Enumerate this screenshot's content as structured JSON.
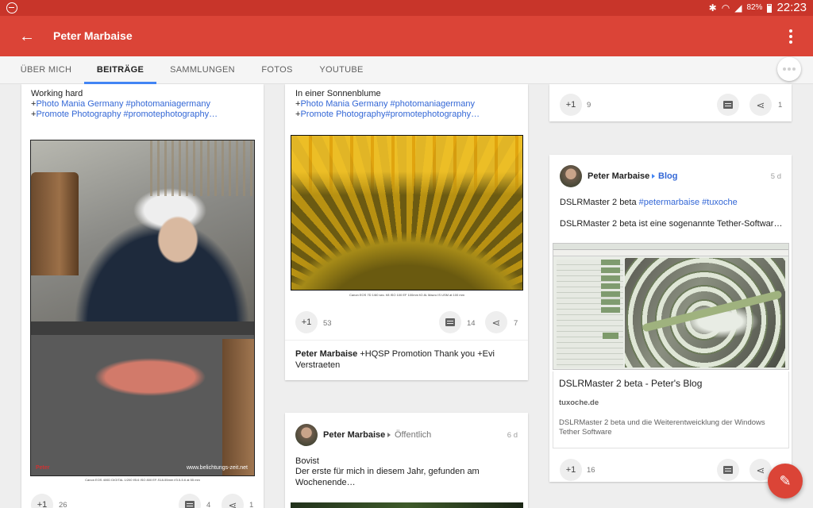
{
  "status_bar": {
    "battery": "82%",
    "time": "22:23"
  },
  "app_bar": {
    "title": "Peter Marbaise"
  },
  "tabs": [
    {
      "label": "ÜBER MICH"
    },
    {
      "label": "BEITRÄGE",
      "active": true
    },
    {
      "label": "SAMMLUNGEN"
    },
    {
      "label": "FOTOS"
    },
    {
      "label": "YOUTUBE"
    }
  ],
  "posts": {
    "working_hard": {
      "line1": "Working hard",
      "line2_prefix": "+",
      "line2_link": "Photo Mania Germany #photomaniagermany",
      "line3_prefix": "+",
      "line3_link": "Promote Photography #promotephotography…",
      "photo_watermark": "www.belichtungs-zeit.net",
      "photo_caption": "Canon EOS 400D DIGITAL 1/200 f/5.6 ISO 800 EF-S18-55mm f/3.5-5.6 at 55 mm",
      "plus_one": "+1",
      "plus_count": "26",
      "comments": "4",
      "shares": "1"
    },
    "sonnenblume": {
      "line1": "In einer Sonnenblume",
      "line2_prefix": "+",
      "line2_link": "Photo Mania Germany #photomaniagermany",
      "line3_prefix": "+",
      "line3_link": "Promote Photography#promotephotography…",
      "photo_caption": "Canon EOS 7D 1/60 sec. f/8 ISO 100 EF 100mm f/2.8L Macro IS USM at 100 mm",
      "plus_one": "+1",
      "plus_count": "53",
      "comments": "14",
      "shares": "7",
      "comment_author": "Peter Marbaise",
      "comment_text": " +HQSP Promotion Thank you +Evi Verstraeten"
    },
    "bovist": {
      "author": "Peter Marbaise",
      "audience": "Öffentlich",
      "date": "6 d",
      "line1": "Bovist",
      "line2": "Der erste für mich in diesem Jahr, gefunden am Wochenende…"
    },
    "top_right": {
      "plus_one": "+1",
      "plus_count": "9",
      "shares": "1"
    },
    "dslrmaster": {
      "author": "Peter Marbaise",
      "collection": "Blog",
      "date": "5 d",
      "line1_text": "DSLRMaster 2 beta ",
      "line1_link": "#petermarbaise #tuxoche",
      "line2": "DSLRMaster 2 beta ist eine sogenannte Tether-Softwar…",
      "link_title": "DSLRMaster 2 beta - Peter's Blog",
      "link_domain": "tuxoche.de",
      "link_desc": "DSLRMaster 2 beta und die Weiterentweicklung der Windows Tether Software",
      "plus_one": "+1",
      "plus_count": "16"
    }
  },
  "colors": {
    "app_bar": "#db4437",
    "status_bar": "#c8352a",
    "tab_indicator": "#4285f4",
    "link": "#3367d6"
  },
  "icons": {
    "back": "arrow-left-icon",
    "overflow": "more-vert-icon",
    "fab": "pencil-icon"
  }
}
